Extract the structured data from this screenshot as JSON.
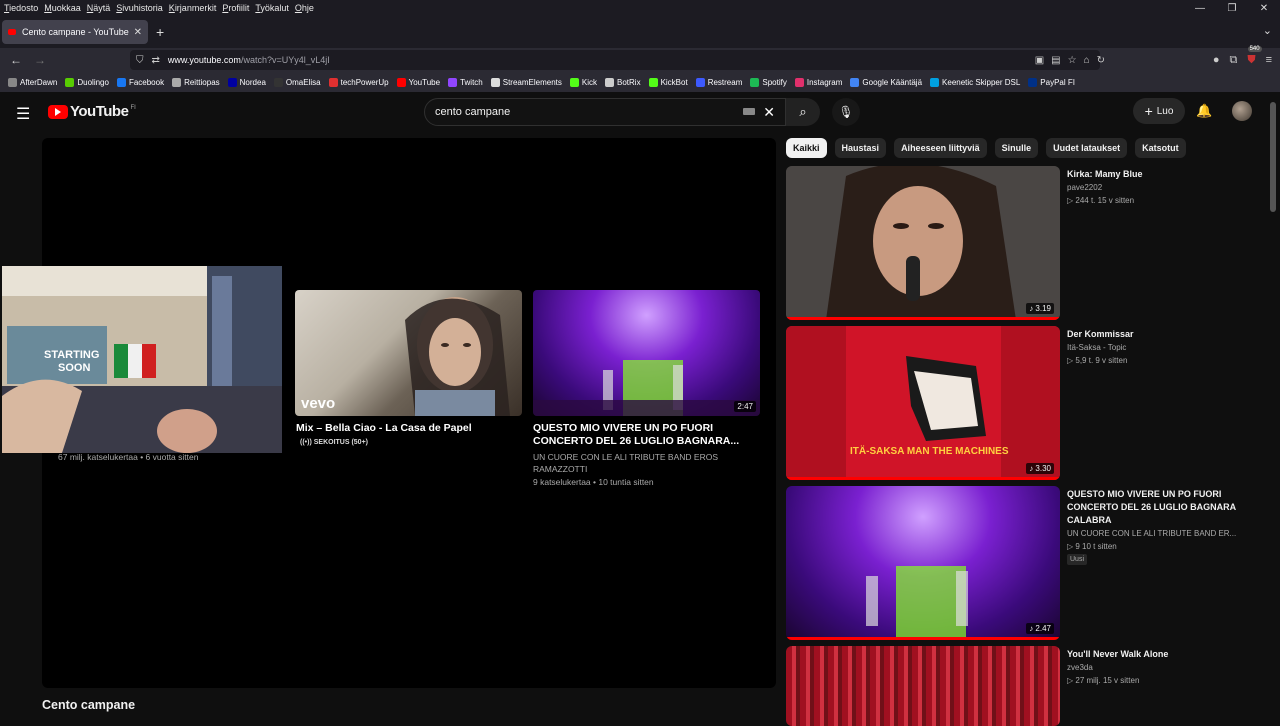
{
  "menubar": [
    "Tiedosto",
    "Muokkaa",
    "Näytä",
    "Sivuhistoria",
    "Kirjanmerkit",
    "Profiilit",
    "Työkalut",
    "Ohje"
  ],
  "tab": {
    "title": "Cento campane - YouTube"
  },
  "url": {
    "host": "www.youtube.com",
    "path": "/watch?v=UYy4l_vL4jI"
  },
  "toolbar": {
    "badge": "540"
  },
  "bookmarks": [
    {
      "label": "AfterDawn",
      "color": "#888888"
    },
    {
      "label": "Duolingo",
      "color": "#58cc02"
    },
    {
      "label": "Facebook",
      "color": "#1877f2"
    },
    {
      "label": "Reittiopas",
      "color": "#aaaaaa"
    },
    {
      "label": "Nordea",
      "color": "#0000a0"
    },
    {
      "label": "OmaElisa",
      "color": "#333333"
    },
    {
      "label": "techPowerUp",
      "color": "#e03030"
    },
    {
      "label": "YouTube",
      "color": "#ff0000"
    },
    {
      "label": "Twitch",
      "color": "#9146ff"
    },
    {
      "label": "StreamElements",
      "color": "#dddddd"
    },
    {
      "label": "Kick",
      "color": "#53fc18"
    },
    {
      "label": "BotRix",
      "color": "#cccccc"
    },
    {
      "label": "KickBot",
      "color": "#53fc18"
    },
    {
      "label": "Restream",
      "color": "#3d5afe"
    },
    {
      "label": "Spotify",
      "color": "#1db954"
    },
    {
      "label": "Instagram",
      "color": "#e1306c"
    },
    {
      "label": "Google Kääntäjä",
      "color": "#4285f4"
    },
    {
      "label": "Keenetic Skipper DSL",
      "color": "#00a0e0"
    },
    {
      "label": "PayPal FI",
      "color": "#003087"
    }
  ],
  "youtube": {
    "logo_text": "YouTube",
    "country": "FI",
    "search_value": "cento campane",
    "create_label": "Luo",
    "video_title": "Cento campane",
    "endscreen": [
      {
        "title": "",
        "sub": "67 milj. katselukertaa • 6 vuotta sitten"
      },
      {
        "title": "Mix – Bella Ciao - La Casa de Papel",
        "sub": "SEKOITUS (50+)",
        "overlay": "vevo"
      },
      {
        "title": "QUESTO MIO VIVERE UN PO FUORI CONCERTO DEL 26 LUGLIO BAGNARA...",
        "sub1": "UN CUORE CON LE ALI TRIBUTE BAND EROS RAMAZZOTTI",
        "sub2": "9 katselukertaa • 10 tuntia sitten",
        "duration": "2:47"
      }
    ],
    "webcam_sign": [
      "STARTING",
      "SOON"
    ],
    "chips": [
      "Kaikki",
      "Haustasi",
      "Aiheeseen liittyviä",
      "Sinulle",
      "Uudet lataukset",
      "Katsotut"
    ],
    "recommendations": [
      {
        "title": "Kirka: Mamy Blue",
        "channel": "pave2202",
        "meta": "▷ 244 t.   15 v sitten",
        "duration": "♪ 3.19"
      },
      {
        "title": "Der Kommissar",
        "channel": "Itä-Saksa - Topic",
        "meta": "▷ 5,9 t.   9 v sitten",
        "duration": "♪ 3.30",
        "cover_text": "ITÄ-SAKSA   MAN THE MACHINES"
      },
      {
        "title": "QUESTO MIO VIVERE UN PO  FUORI CONCERTO DEL 26 LUGLIO BAGNARA CALABRA",
        "channel": "UN CUORE CON LE ALI TRIBUTE BAND ER...",
        "meta": "▷ 9   10 t sitten",
        "badge": "Uusi",
        "duration": "♪ 2.47"
      },
      {
        "title": "You'll Never Walk Alone",
        "channel": "zve3da",
        "meta": "▷ 27 milj.   15 v sitten"
      }
    ]
  }
}
